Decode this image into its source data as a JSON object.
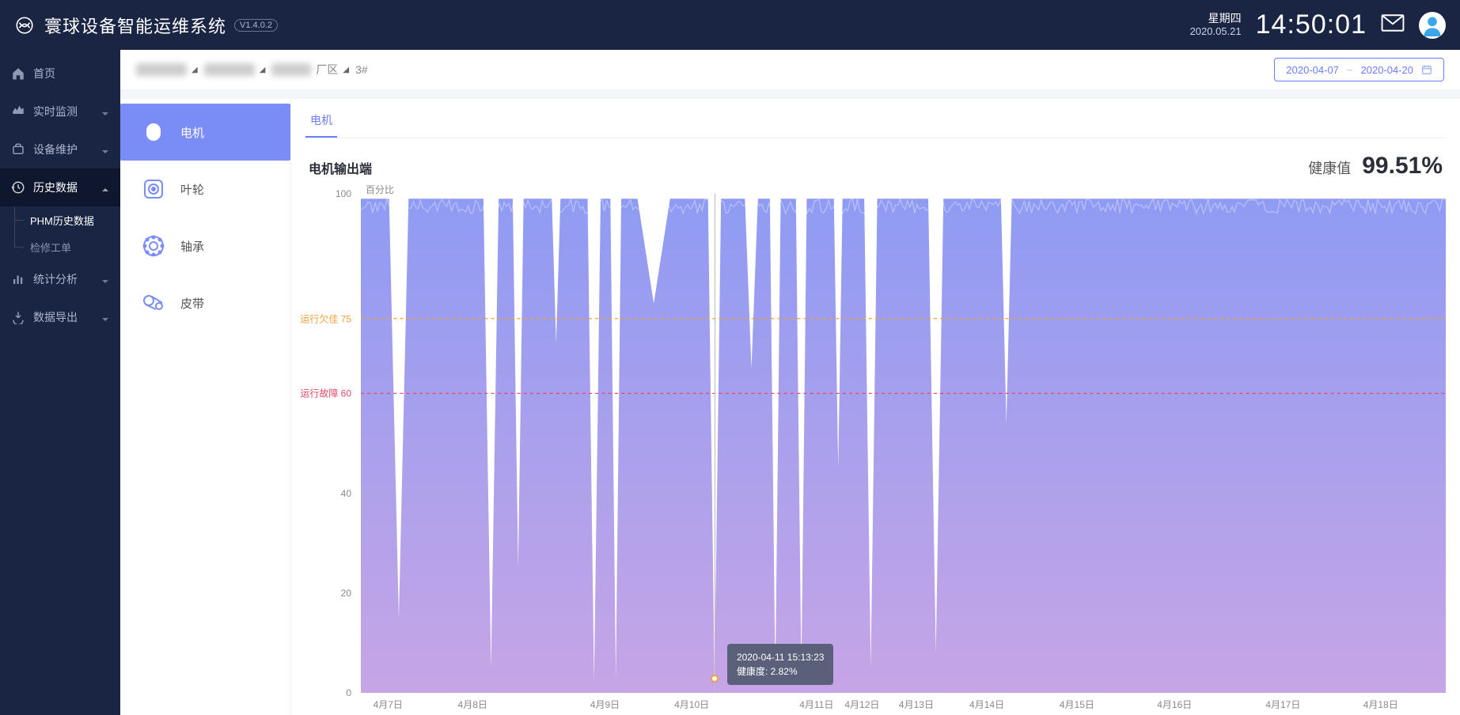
{
  "header": {
    "product_name": "寰球设备智能运维系统",
    "version": "V1.4.0.2",
    "weekday": "星期四",
    "date": "2020.05.21",
    "clock": "14:50:01"
  },
  "sidebar": {
    "items": [
      {
        "icon": "home",
        "label": "首页",
        "expandable": false
      },
      {
        "icon": "monitor",
        "label": "实时监测",
        "expandable": true
      },
      {
        "icon": "maintain",
        "label": "设备维护",
        "expandable": true
      },
      {
        "icon": "history",
        "label": "历史数据",
        "expandable": true,
        "active": true,
        "children": [
          {
            "label": "PHM历史数据",
            "active": true
          },
          {
            "label": "检修工单",
            "active": false
          }
        ]
      },
      {
        "icon": "stats",
        "label": "统计分析",
        "expandable": true
      },
      {
        "icon": "export",
        "label": "数据导出",
        "expandable": true
      }
    ]
  },
  "breadcrumb": {
    "segments": [
      {
        "text": "",
        "redacted": true
      },
      {
        "text": "",
        "redacted": true
      },
      {
        "text": "厂区",
        "redacted_prefix": true
      },
      {
        "text": "3#",
        "redacted": false
      }
    ],
    "date_from": "2020-04-07",
    "date_sep": "~",
    "date_to": "2020-04-20"
  },
  "components": [
    {
      "key": "motor",
      "label": "电机",
      "active": true
    },
    {
      "key": "impeller",
      "label": "叶轮",
      "active": false
    },
    {
      "key": "bearing",
      "label": "轴承",
      "active": false
    },
    {
      "key": "belt",
      "label": "皮带",
      "active": false
    }
  ],
  "tabs": [
    {
      "label": "电机",
      "active": true
    }
  ],
  "section": {
    "title": "电机输出端",
    "health_label": "健康值",
    "health_value": "99.51%"
  },
  "tooltip": {
    "timestamp": "2020-04-11 15:13:23",
    "metric_label": "健康度",
    "metric_value": "2.82%",
    "x_fraction": 0.326,
    "y_value": 2.82
  },
  "chart_data": {
    "type": "area",
    "title": "电机输出端",
    "ylabel": "百分比",
    "xlabel": "",
    "ylim": [
      0,
      100
    ],
    "y_ticks": [
      0,
      20,
      40,
      100
    ],
    "guidelines": [
      {
        "label": "运行欠佳",
        "value": 75,
        "style": "warn"
      },
      {
        "label": "运行故障",
        "value": 60,
        "style": "fault"
      }
    ],
    "x_categories": [
      "4月7日",
      "4月8日",
      "4月9日",
      "4月10日",
      "4月11日",
      "4月12日",
      "4月13日",
      "4月14日",
      "4月15日",
      "4月16日",
      "4月17日",
      "4月18日"
    ],
    "x_positions_fraction": [
      0.025,
      0.103,
      0.225,
      0.305,
      0.42,
      0.462,
      0.512,
      0.577,
      0.66,
      0.75,
      0.85,
      0.94
    ],
    "series": [
      {
        "name": "健康度",
        "baseline": 99,
        "dips": [
          {
            "x": 0.035,
            "low": 15,
            "width": 0.018
          },
          {
            "x": 0.12,
            "low": 5,
            "width": 0.014
          },
          {
            "x": 0.145,
            "low": 25,
            "width": 0.01
          },
          {
            "x": 0.18,
            "low": 70,
            "width": 0.008
          },
          {
            "x": 0.215,
            "low": 2,
            "width": 0.012
          },
          {
            "x": 0.235,
            "low": 3,
            "width": 0.01
          },
          {
            "x": 0.27,
            "low": 78,
            "width": 0.03
          },
          {
            "x": 0.326,
            "low": 2.82,
            "width": 0.012
          },
          {
            "x": 0.36,
            "low": 65,
            "width": 0.012
          },
          {
            "x": 0.382,
            "low": 3,
            "width": 0.01
          },
          {
            "x": 0.406,
            "low": 4,
            "width": 0.01
          },
          {
            "x": 0.44,
            "low": 45,
            "width": 0.008
          },
          {
            "x": 0.47,
            "low": 5,
            "width": 0.012
          },
          {
            "x": 0.53,
            "low": 8,
            "width": 0.014
          },
          {
            "x": 0.595,
            "low": 54,
            "width": 0.01
          }
        ]
      }
    ],
    "colors": {
      "area_top": "#8f9bf3",
      "area_bottom": "#c6a5e6",
      "line": "#7a8cf6"
    }
  }
}
